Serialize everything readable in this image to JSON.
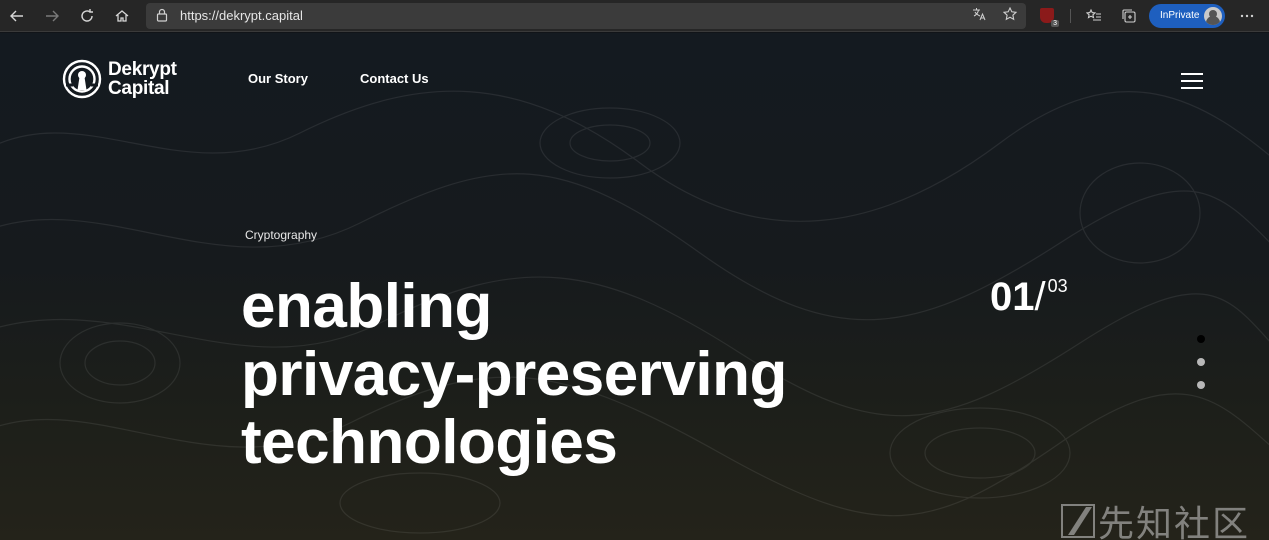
{
  "browser": {
    "url": "https://dekrypt.capital",
    "extension_badge": "3",
    "inprivate_label": "InPrivate"
  },
  "site": {
    "logo_line1": "Dekrypt",
    "logo_line2": "Capital",
    "nav": [
      {
        "label": "Our Story"
      },
      {
        "label": "Contact Us"
      }
    ],
    "eyebrow": "Cryptography",
    "headline": [
      "enabling",
      "privacy-preserving",
      "technologies"
    ],
    "slide_current": "01",
    "slide_sep": "/",
    "slide_total": "03"
  },
  "watermark": "先知社区",
  "colors": {
    "inprivate": "#1e5fbf",
    "background_top": "#141a20",
    "background_bottom": "#24231a"
  }
}
